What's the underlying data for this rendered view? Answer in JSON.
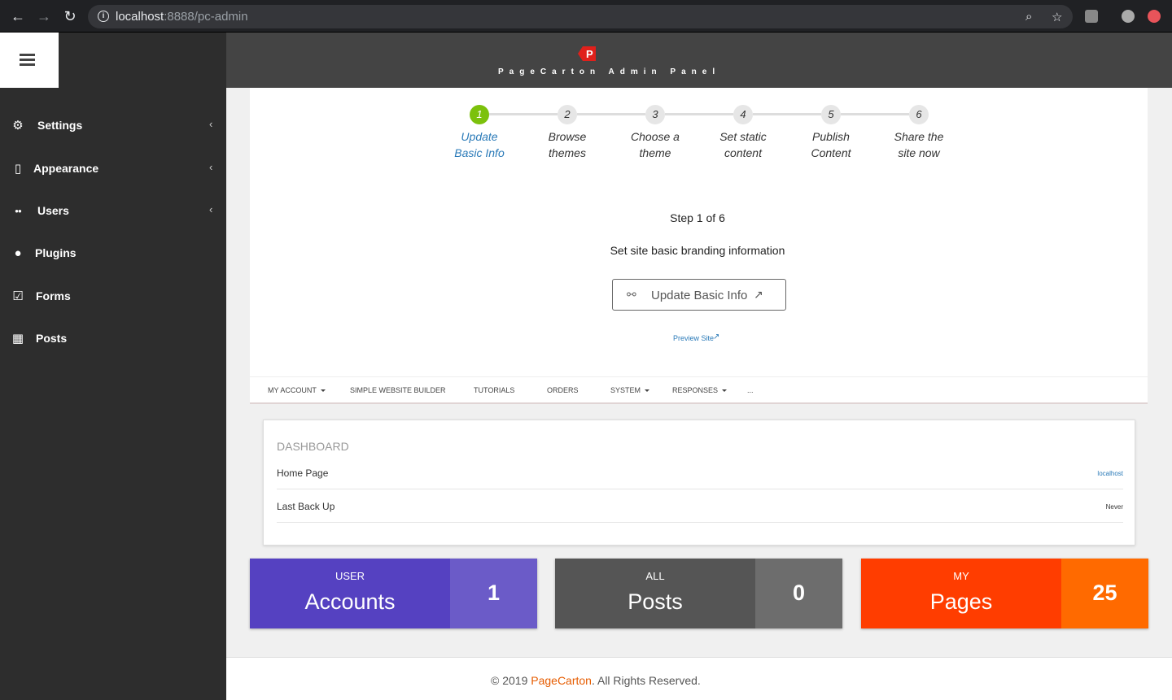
{
  "browser": {
    "url_host": "localhost",
    "url_rest": ":8888/pc-admin"
  },
  "header": {
    "brand_title": "PageCarton Admin Panel",
    "logo_letter": "P"
  },
  "sidebar": {
    "items": [
      {
        "label": "Settings",
        "icon": "gears-icon",
        "glyph": "⚙",
        "has_submenu": true
      },
      {
        "label": "Appearance",
        "icon": "file-icon",
        "glyph": "▯",
        "has_submenu": true
      },
      {
        "label": "Users",
        "icon": "users-icon",
        "glyph": "●●",
        "has_submenu": true
      },
      {
        "label": "Plugins",
        "icon": "circle-icon",
        "glyph": "●",
        "has_submenu": false
      },
      {
        "label": "Forms",
        "icon": "checkbox-icon",
        "glyph": "☑",
        "has_submenu": false
      },
      {
        "label": "Posts",
        "icon": "grid-icon",
        "glyph": "▦",
        "has_submenu": false
      }
    ],
    "chevron": "‹"
  },
  "wizard": {
    "steps": [
      {
        "number": "1",
        "line1": "Update",
        "line2": "Basic Info",
        "active": true
      },
      {
        "number": "2",
        "line1": "Browse",
        "line2": "themes",
        "active": false
      },
      {
        "number": "3",
        "line1": "Choose a",
        "line2": "theme",
        "active": false
      },
      {
        "number": "4",
        "line1": "Set static",
        "line2": "content",
        "active": false
      },
      {
        "number": "5",
        "line1": "Publish",
        "line2": "Content",
        "active": false
      },
      {
        "number": "6",
        "line1": "Share the",
        "line2": "site now",
        "active": false
      }
    ],
    "step_count": "Step 1 of 6",
    "description": "Set site basic branding information",
    "button_label": "Update Basic Info",
    "preview_label": "Preview Site"
  },
  "subnav": {
    "items": [
      {
        "label": "MY ACCOUNT",
        "has_caret": true
      },
      {
        "label": "SIMPLE WEBSITE BUILDER",
        "has_caret": false
      },
      {
        "label": "TUTORIALS",
        "has_caret": false
      },
      {
        "label": "ORDERS",
        "has_caret": false
      },
      {
        "label": "SYSTEM",
        "has_caret": true
      },
      {
        "label": "RESPONSES",
        "has_caret": true
      },
      {
        "label": "...",
        "has_caret": false
      }
    ]
  },
  "dashboard": {
    "title": "DASHBOARD",
    "rows": [
      {
        "label": "Home Page",
        "value": "localhost"
      },
      {
        "label": "Last Back Up",
        "value": "Never"
      }
    ]
  },
  "tiles": [
    {
      "top": "USER",
      "main": "Accounts",
      "count": "1",
      "color_left": "#5541c1",
      "color_right": "#6b5bc8"
    },
    {
      "top": "ALL",
      "main": "Posts",
      "count": "0",
      "color_left": "#555555",
      "color_right": "#6d6d6d"
    },
    {
      "top": "MY",
      "main": "Pages",
      "count": "25",
      "color_left": "#ff3d00",
      "color_right": "#ff6a00"
    }
  ],
  "footer": {
    "prefix": "© 2019 ",
    "brand": "PageCarton",
    "suffix": ". All Rights Reserved."
  }
}
